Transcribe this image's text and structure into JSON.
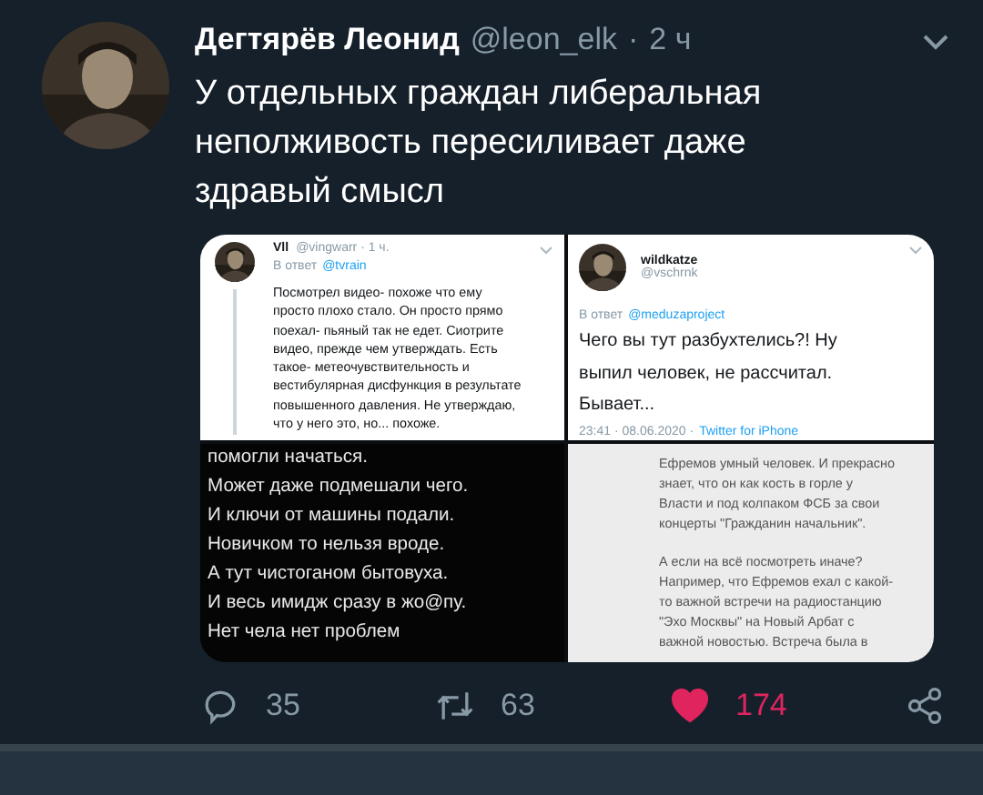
{
  "tweet": {
    "author": {
      "name": "Дегтярёв Леонид",
      "handle": "@leon_elk",
      "separator": "·",
      "time": "2 ч"
    },
    "text": "У отдельных граждан либеральная неполживость пересиливает даже здравый смысл",
    "media": [
      {
        "kind": "tweet_card",
        "name": "Vll",
        "handle": "@vingwarr · 1 ч.",
        "reply_label": "В ответ",
        "reply_to": "@tvrain",
        "lines": [
          "Посмотрел видео- похоже что ему",
          "просто плохо стало. Он просто прямо",
          "поехал- пьяный так не едет. Сиотрите",
          "видео, прежде чем утверждать. Есть",
          "такое- метеочувствительность и",
          "вестибулярная дисфункция в результате",
          "повышенного давления. Не утверждаю,",
          "что у него это, но... похоже."
        ]
      },
      {
        "kind": "tweet_detail",
        "name": "wildkatze",
        "handle": "@vschrnk",
        "reply_label": "В ответ",
        "reply_to": "@meduzaproject",
        "lines": [
          "Чего вы тут разбухтелись?! Ну",
          "выпил человек, не рассчитал.",
          "Бывает..."
        ],
        "footer": "23:41 · 08.06.2020 ·",
        "source": "Twitter for iPhone"
      },
      {
        "kind": "dark_text",
        "lines": [
          "помогли начаться.",
          "Может даже подмешали чего.",
          "И ключи от машины подали.",
          "Новичком то нельзя вроде.",
          "А тут чистоганом бытовуха.",
          "И весь имидж сразу в жо@пу.",
          "Нет чела нет проблем"
        ]
      },
      {
        "kind": "light_text",
        "paragraphs": [
          [
            "Ефремов умный человек. И прекрасно",
            "знает, что он как кость в горле у",
            "Власти и под колпаком ФСБ за свои",
            "концерты \"Гражданин начальник\"."
          ],
          [
            "А если на всё посмотреть иначе?",
            "Например, что Ефремов ехал с какой-",
            "то важной встречи на радиостанцию",
            "\"Эхо Москвы\" на Новый Арбат с",
            "важной новостью. Встреча была в"
          ]
        ]
      }
    ],
    "actions": [
      {
        "kind": "reply",
        "count": "35",
        "active": false
      },
      {
        "kind": "retweet",
        "count": "63",
        "active": false
      },
      {
        "kind": "like",
        "count": "174",
        "active": true
      },
      {
        "kind": "share",
        "active": false
      }
    ]
  }
}
